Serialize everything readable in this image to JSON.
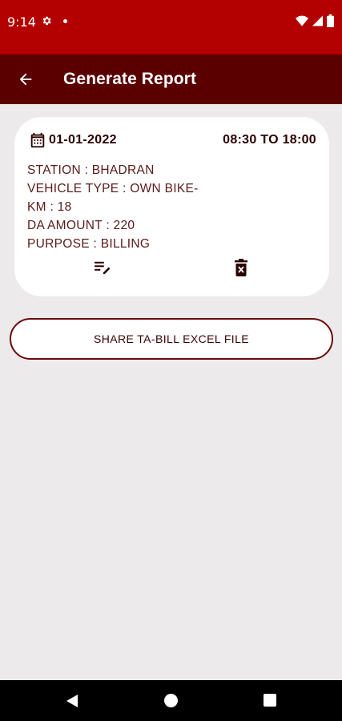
{
  "status_bar": {
    "time": "9:14",
    "icons": [
      "gear-icon",
      "dot-icon",
      "wifi-icon",
      "signal-icon",
      "battery-icon"
    ]
  },
  "app_bar": {
    "title": "Generate Report",
    "back_icon": "arrow-back-icon"
  },
  "report_card": {
    "date": "01-01-2022",
    "time_range": "08:30 TO 18:00",
    "station": "STATION : BHADRAN",
    "vehicle_type_line1": "VEHICLE TYPE : OWN BIKE-",
    "km": "KM : 18",
    "da_amount": "DA AMOUNT : 220",
    "purpose": "PURPOSE : BILLING",
    "edit_icon": "edit-list-icon",
    "delete_icon": "delete-icon"
  },
  "share_button": {
    "label": "SHARE TA-BILL EXCEL FILE"
  },
  "nav_bar": {
    "icons": [
      "nav-back-icon",
      "nav-home-icon",
      "nav-recents-icon"
    ]
  },
  "colors": {
    "status_bar": "#b30000",
    "app_bar": "#5a0000",
    "background": "#eceaeb",
    "card": "#ffffff",
    "accent_text": "#2b0000",
    "button_border": "#6b0a0a"
  }
}
